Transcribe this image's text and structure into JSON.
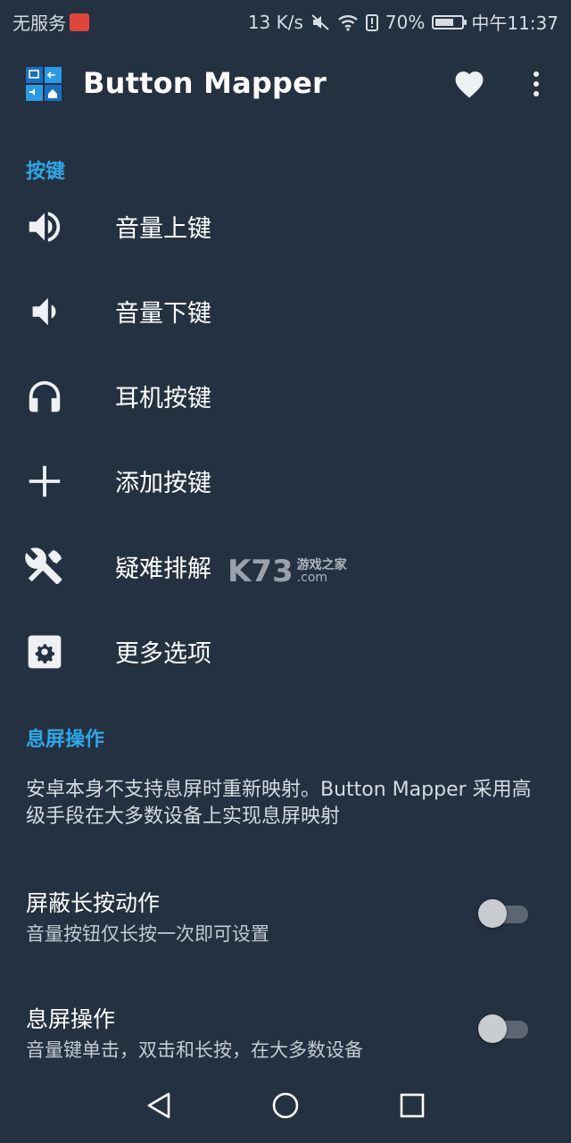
{
  "status_bar": {
    "carrier": "无服务",
    "speed": "13 K/s",
    "battery": "70%",
    "battery_level": 0.7,
    "time": "中午11:37"
  },
  "app_bar": {
    "title": "Button Mapper"
  },
  "sections": {
    "buttons_header": "按键",
    "screen_off_header": "息屏操作"
  },
  "menu": {
    "items": [
      {
        "label": "音量上键",
        "icon": "volume-up-icon"
      },
      {
        "label": "音量下键",
        "icon": "volume-down-icon"
      },
      {
        "label": "耳机按键",
        "icon": "headset-icon"
      },
      {
        "label": "添加按键",
        "icon": "plus-icon"
      },
      {
        "label": "疑难排解",
        "icon": "tools-icon"
      },
      {
        "label": "更多选项",
        "icon": "gear-icon"
      }
    ]
  },
  "watermark": {
    "main": "K73",
    "cn": "游戏之家",
    "domain": ".com"
  },
  "screen_off": {
    "description": "安卓本身不支持息屏时重新映射。Button Mapper 采用高级手段在大多数设备上实现息屏映射",
    "settings": [
      {
        "title": "屏蔽长按动作",
        "subtitle": "音量按钮仅长按一次即可设置",
        "enabled": false
      },
      {
        "title": "息屏操作",
        "subtitle": "音量键单击，双击和长按，在大多数设备",
        "enabled": false
      }
    ]
  },
  "colors": {
    "background": "#243140",
    "accent": "#2ea7e8",
    "text_primary": "#ffffff",
    "text_secondary": "#c3cbd3"
  }
}
